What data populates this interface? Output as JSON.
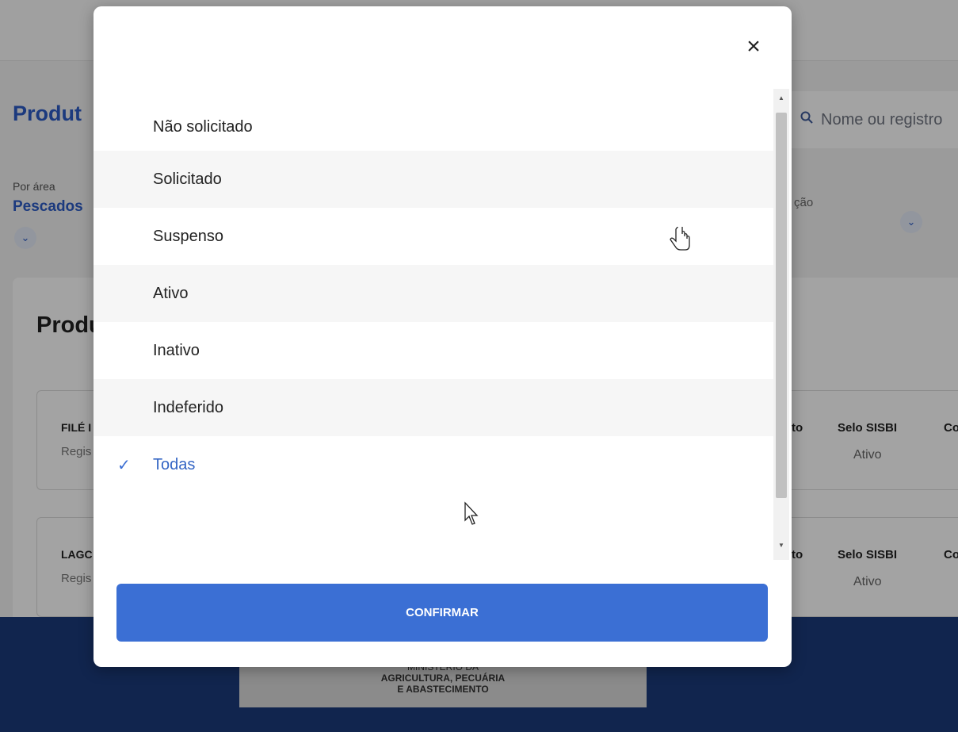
{
  "background": {
    "page_title": "Produt",
    "search_placeholder": "Nome ou registro",
    "filter_area_label": "Por área",
    "filter_area_value": "Pescados",
    "filter2_label": "ção",
    "section_title": "Produ",
    "cards": [
      {
        "name": "FILÉ I",
        "sub": "Regis",
        "col_header_partial": "to",
        "seal_header": "Selo SISBI",
        "seal_value": "Ativo",
        "col3_header": "Co"
      },
      {
        "name": "LAGC",
        "sub": "Regis",
        "col_header_partial": "to",
        "seal_header": "Selo SISBI",
        "seal_value": "Ativo",
        "col3_header": "Co"
      }
    ],
    "footer_logo": {
      "line1": "MINISTÉRIO DA",
      "line2": "AGRICULTURA, PECUÁRIA",
      "line3": "E ABASTECIMENTO"
    }
  },
  "modal": {
    "close_symbol": "×",
    "options": [
      {
        "label": "Não solicitado",
        "selected": false
      },
      {
        "label": "Solicitado",
        "selected": false
      },
      {
        "label": "Suspenso",
        "selected": false
      },
      {
        "label": "Ativo",
        "selected": false
      },
      {
        "label": "Inativo",
        "selected": false
      },
      {
        "label": "Indeferido",
        "selected": false
      },
      {
        "label": "Todas",
        "selected": true
      }
    ],
    "check_symbol": "✓",
    "confirm_label": "CONFIRMAR"
  },
  "colors": {
    "accent": "#3b6fd4",
    "selected_text": "#3465c4",
    "footer": "#1b3a7a"
  }
}
